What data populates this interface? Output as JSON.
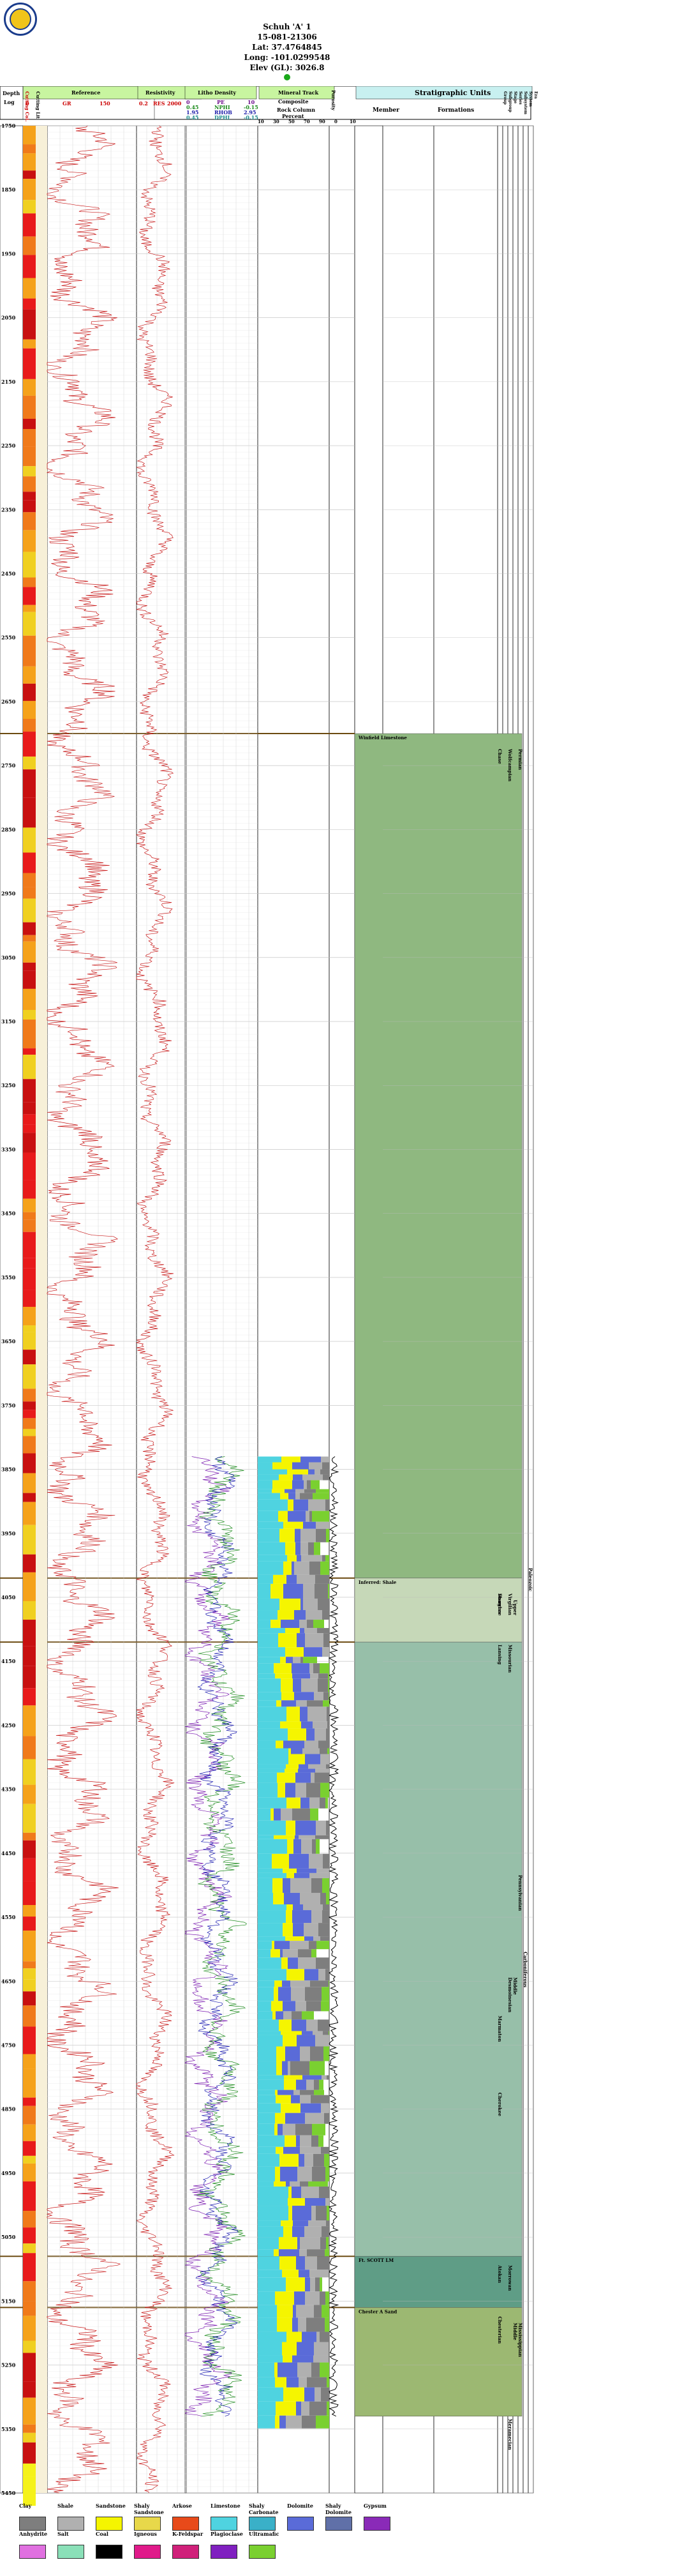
{
  "header": {
    "well_name": "Schuh 'A' 1",
    "api": "15-081-21306",
    "lat": "Lat: 37.4764845",
    "long": "Long: -101.0299548",
    "elev": "Elev (GL): 3026.8"
  },
  "tracks": {
    "depth_title": "Depth",
    "depth_sub": "Log",
    "cutting_title": "Cutting Col.",
    "unit_title": "Cutting Lit",
    "reference_title": "Reference",
    "reference_curve": "GR",
    "reference_min": "0",
    "reference_max": "150",
    "resistivity_title": "Resistivity",
    "resistivity_curve": "RES",
    "resistivity_min": "0.2",
    "resistivity_max": "2000",
    "litho_title": "Litho Density",
    "litho_pe": "PE",
    "litho_pe_min": "0",
    "litho_pe_max": "10",
    "litho_nphi": "NPHI",
    "litho_nphi_min": "0.45",
    "litho_nphi_max": "-0.15",
    "litho_rhob": "RHOB",
    "litho_rhob_min": "1.95",
    "litho_rhob_max": "2.95",
    "litho_dphi": "DPHI",
    "litho_dphi_min": "0.45",
    "litho_dphi_max": "-0.15",
    "mineral_title": "Mineral Track",
    "composite_title": "Composite",
    "rock_column": "Rock Column",
    "percent": "Percent",
    "percent_ticks": [
      "10",
      "30",
      "50",
      "70",
      "90"
    ],
    "porosity_title": "Porosity",
    "porosity_ticks": [
      "0",
      "10"
    ],
    "strat_title": "Stratigraphic Units",
    "member": "Member",
    "formations": "Formations",
    "group": "Group",
    "subgroup": "Subgroup",
    "stage": "Stage",
    "series": "Series",
    "subsystem": "Subsystem",
    "system": "System",
    "era": "Era"
  },
  "depth_labels": [
    "1750",
    "1850",
    "1950",
    "2050",
    "2150",
    "2250",
    "2350",
    "2450",
    "2550",
    "2650",
    "2750",
    "2850",
    "2950",
    "3050",
    "3150",
    "3250",
    "3350",
    "3450",
    "3550",
    "3650",
    "3750",
    "3850",
    "3950",
    "4050",
    "4150",
    "4250",
    "4350",
    "4450",
    "4550",
    "4650",
    "4750",
    "4850",
    "4950",
    "5050",
    "5150",
    "5250",
    "5350",
    "5450"
  ],
  "formations": [
    {
      "name": "Winfield Limestone",
      "top": 2700,
      "base": 4020,
      "color": "#8fb880"
    },
    {
      "name": "Inferred: Shale",
      "top": 4020,
      "base": 4120,
      "color": "#c6d8b8"
    },
    {
      "name": "",
      "top": 4120,
      "base": 5080,
      "color": "#97bfa9"
    },
    {
      "name": "Ft. SCOTT LM",
      "top": 5080,
      "base": 5160,
      "color": "#5f9d86"
    },
    {
      "name": "Chester A Sand",
      "top": 5160,
      "base": 5330,
      "color": "#9cb872"
    }
  ],
  "strat_labels": [
    {
      "text": "Chase",
      "depth": 2720
    },
    {
      "text": "Wolfcampian",
      "depth": 2720
    },
    {
      "text": "Permian",
      "depth": 2720
    },
    {
      "text": "Paleozoic",
      "depth": 4000
    },
    {
      "text": "Shawnee",
      "depth": 4040
    },
    {
      "text": "Douglas",
      "depth": 4040
    },
    {
      "text": "Virgilian",
      "depth": 4040
    },
    {
      "text": "Upper",
      "depth": 4050
    },
    {
      "text": "Lansing",
      "depth": 4120
    },
    {
      "text": "Missourian",
      "depth": 4120
    },
    {
      "text": "Pennsylvanian",
      "depth": 4480
    },
    {
      "text": "Marmaton",
      "depth": 4700
    },
    {
      "text": "Middle",
      "depth": 4640
    },
    {
      "text": "Desmoinesian",
      "depth": 4640
    },
    {
      "text": "Carboniferous",
      "depth": 4600
    },
    {
      "text": "Cherokee",
      "depth": 4820
    },
    {
      "text": "Atokan",
      "depth": 5090
    },
    {
      "text": "Morrowan",
      "depth": 5090
    },
    {
      "text": "Chesterian",
      "depth": 5170
    },
    {
      "text": "Mississippian",
      "depth": 5180
    },
    {
      "text": "Middle",
      "depth": 5180
    },
    {
      "text": "Meramecian",
      "depth": 5330
    }
  ],
  "legend": [
    {
      "label": "Clay",
      "color": "#7e7e7e"
    },
    {
      "label": "Shale",
      "color": "#b0b0b0"
    },
    {
      "label": "Sandstone",
      "color": "#f5f500"
    },
    {
      "label": "Shaly Sandstone",
      "color": "#e8d84a"
    },
    {
      "label": "Arkose",
      "color": "#e84a1a"
    },
    {
      "label": "Limestone",
      "color": "#4fd3e0"
    },
    {
      "label": "Shaly Carbonate",
      "color": "#3ab0c8"
    },
    {
      "label": "Dolomite",
      "color": "#5a6bd8"
    },
    {
      "label": "Shaly Dolomite",
      "color": "#6070a8"
    },
    {
      "label": "Gypsum",
      "color": "#8a2ab8"
    },
    {
      "label": "Anhydrite",
      "color": "#e070e0"
    },
    {
      "label": "Salt",
      "color": "#8ae0b8"
    },
    {
      "label": "Coal",
      "color": "#000000"
    },
    {
      "label": "Igneous",
      "color": "#e01a8a"
    },
    {
      "label": "K-Feldspar",
      "color": "#d0207a"
    },
    {
      "label": "Plagioclase",
      "color": "#8020c0"
    },
    {
      "label": "Ultramafic",
      "color": "#7ad030"
    }
  ]
}
